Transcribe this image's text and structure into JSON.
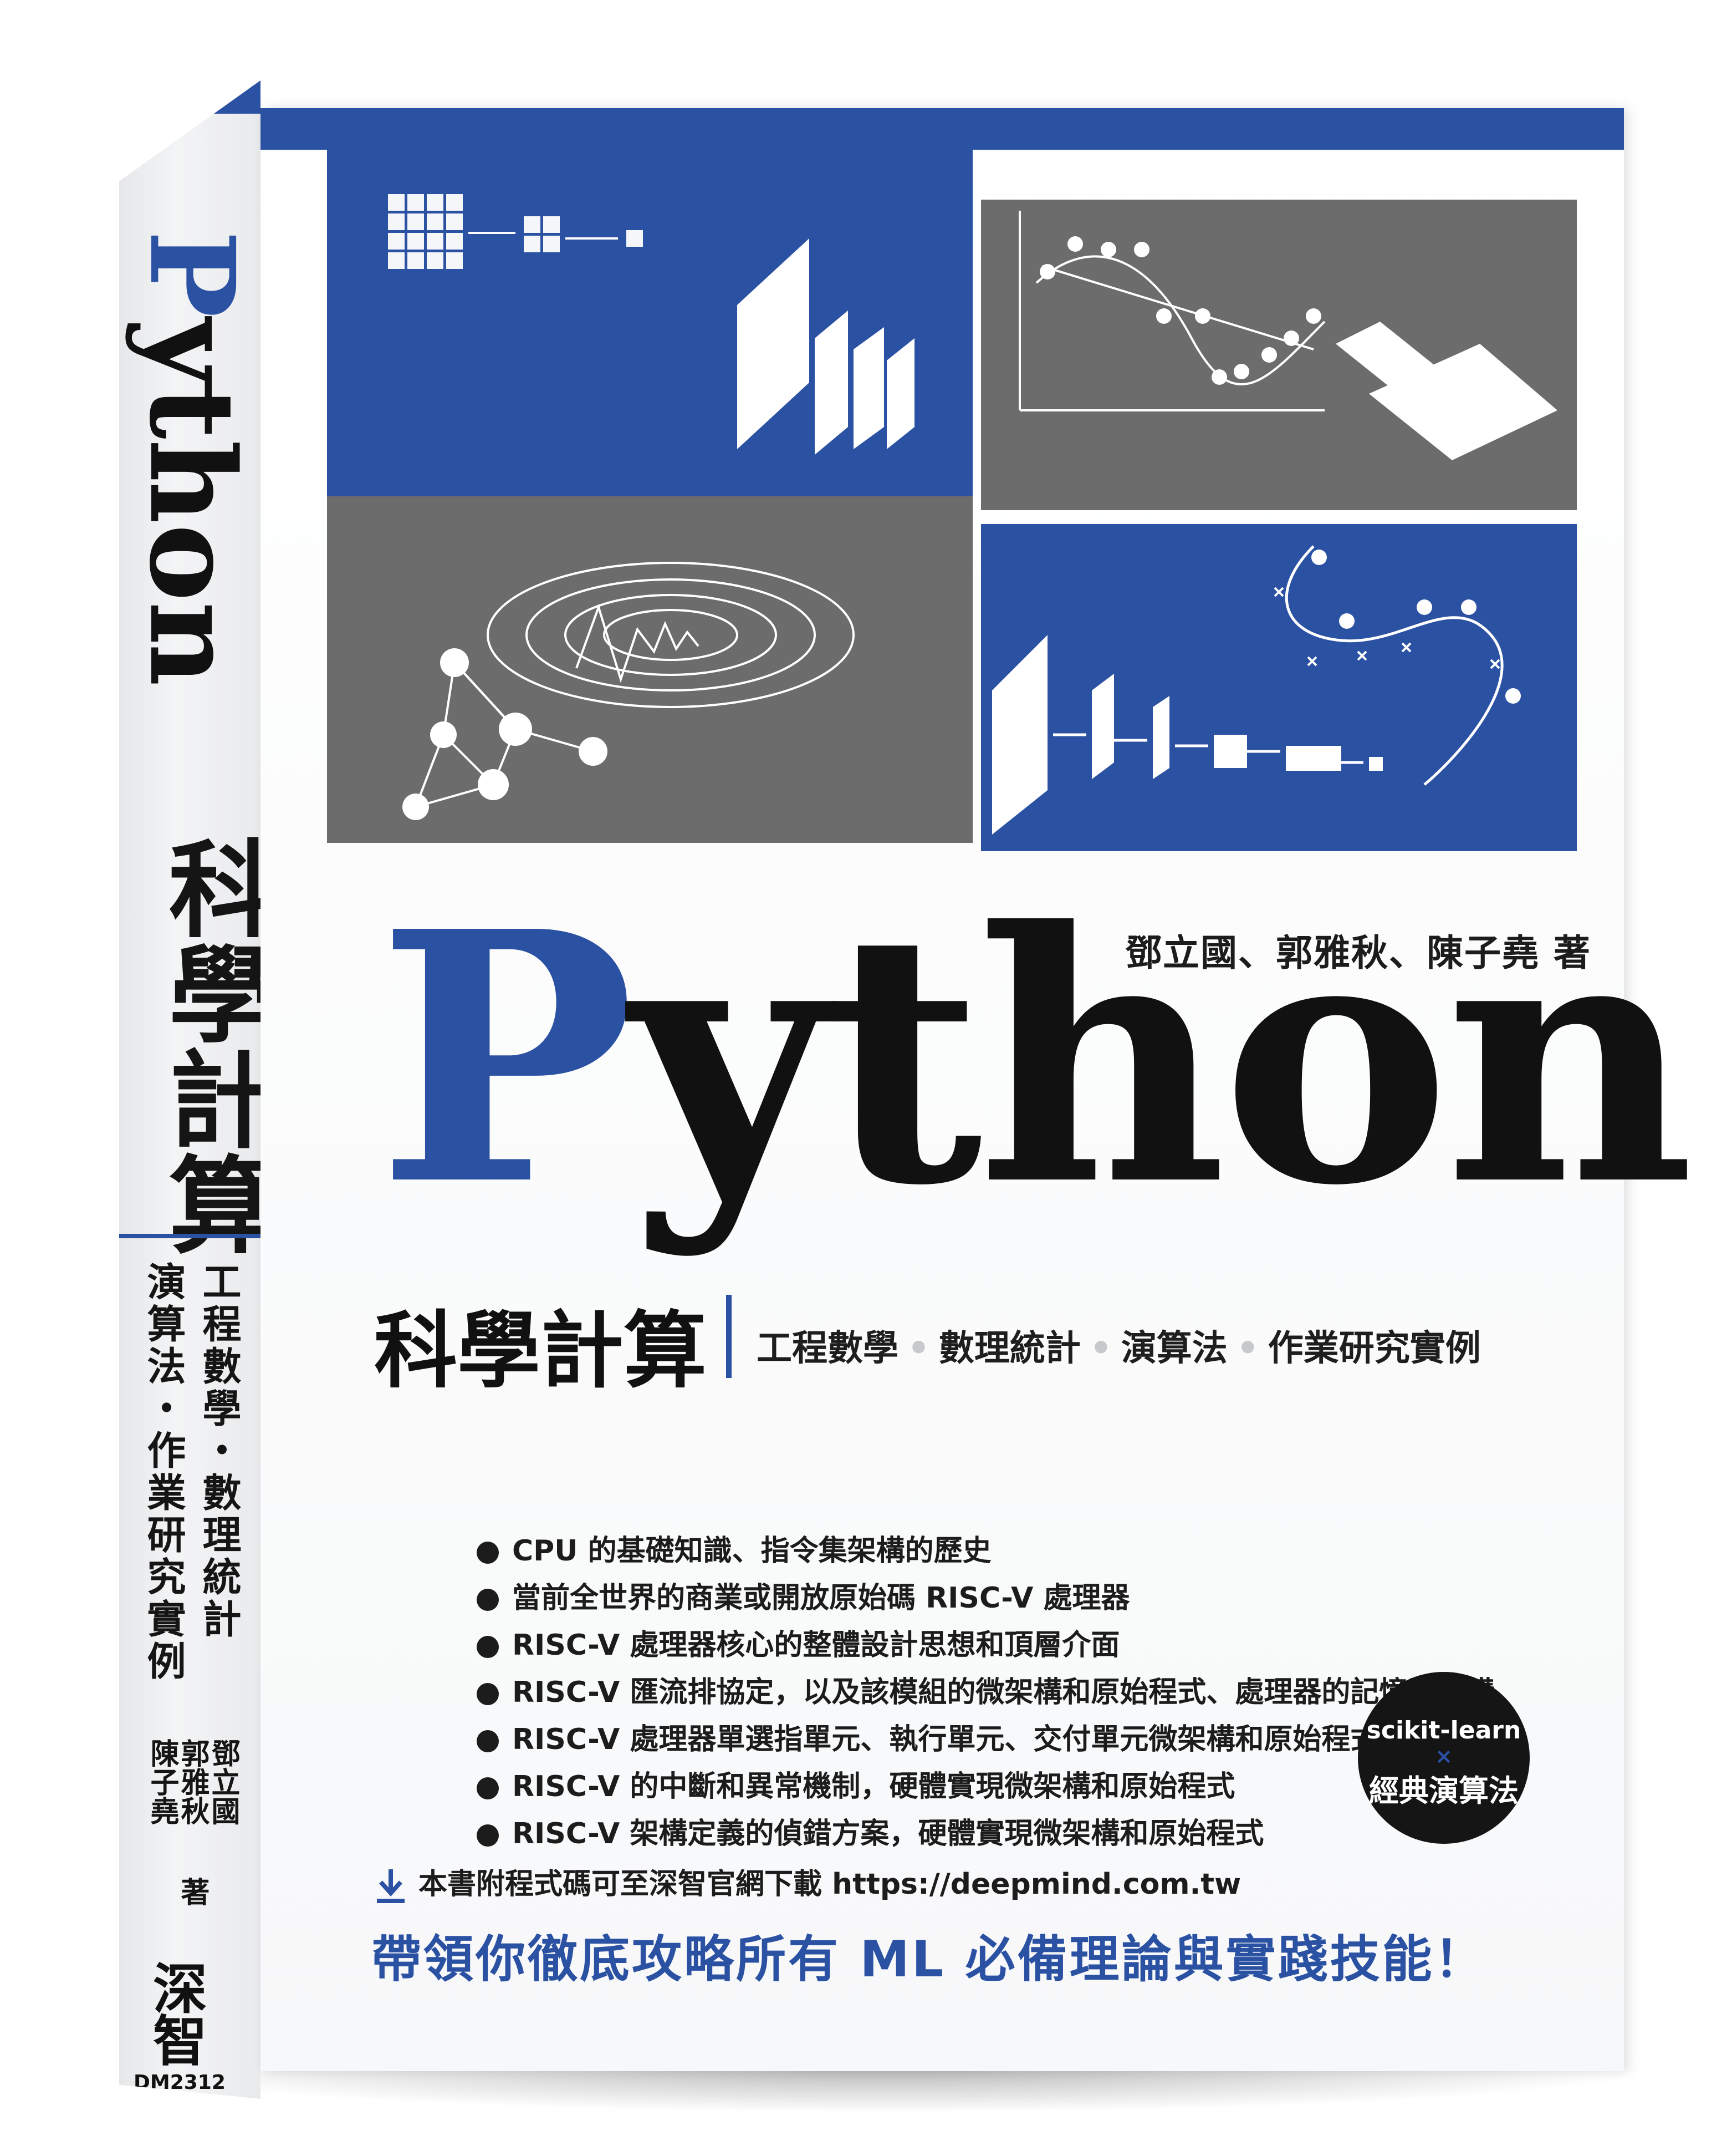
{
  "colors": {
    "accent": "#2b51a3",
    "panel_gray": "#6c6c6c",
    "text": "#111111"
  },
  "spine": {
    "title_en": "Python",
    "title_cn": "科學計算",
    "topics_line1": "工程數學・數理統計",
    "topics_line2": "演算法・作業研究實例",
    "author_1": "鄧立國",
    "author_2": "郭雅秋",
    "author_3": "陳子堯",
    "author_suffix": "著",
    "publisher": "深智",
    "code": "DM2312"
  },
  "cover": {
    "authors": "鄧立國、郭雅秋、陳子堯 著",
    "title_first_letter": "P",
    "title_rest": "ython",
    "subtitle": "科學計算",
    "topics": [
      "工程數學",
      "數理統計",
      "演算法",
      "作業研究實例"
    ],
    "bullets": [
      "CPU 的基礎知識、指令集架構的歷史",
      "當前全世界的商業或開放原始碼 RISC-V 處理器",
      "RISC-V 處理器核心的整體設計思想和頂層介面",
      "RISC-V 匯流排協定，以及該模組的微架構和原始程式、處理器的記憶體架構",
      "RISC-V 處理器單選指單元、執行單元、交付單元微架構和原始程式",
      "RISC-V 的中斷和異常機制，硬體實現微架構和原始程式",
      "RISC-V 架構定義的偵錯方案，硬體實現微架構和原始程式"
    ],
    "badge": {
      "line1": "scikit-learn",
      "cross": "×",
      "line2": "經典演算法"
    },
    "download_icon": "download-arrow-icon",
    "download_text": "本書附程式碼可至深智官網下載 https://deepmind.com.tw",
    "slogan": "帶領你徹底攻略所有 ML 必備理論與實踐技能！"
  }
}
